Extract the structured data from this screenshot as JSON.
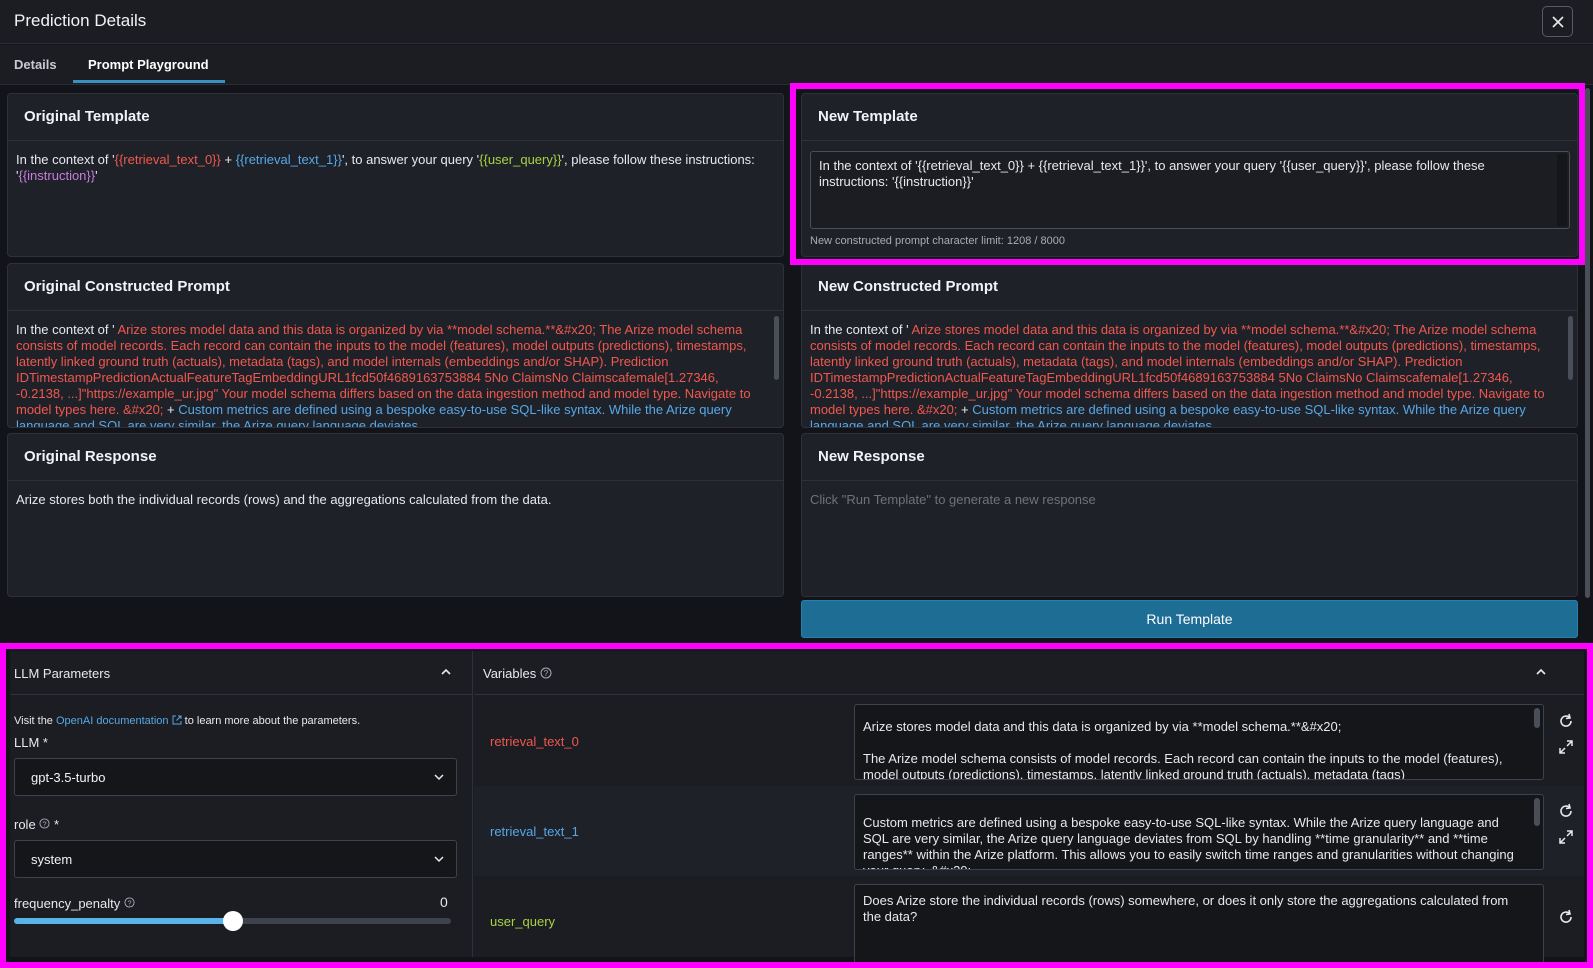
{
  "header": {
    "title": "Prediction Details"
  },
  "tabs": [
    {
      "label": "Details"
    },
    {
      "label": "Prompt Playground"
    }
  ],
  "original_template": {
    "title": "Original Template",
    "parts": [
      "In the context of '",
      "{{retrieval_text_0}}",
      " + ",
      "{{retrieval_text_1}}",
      "', to answer your query '",
      "{{user_query}}",
      "', please follow these instructions: '",
      "{{instruction}}",
      "'"
    ]
  },
  "new_template": {
    "title": "New Template",
    "text": "In the context of '{{retrieval_text_0}} + {{retrieval_text_1}}', to answer your query '{{user_query}}', please follow these instructions: '{{instruction}}'",
    "char_limit": "New constructed prompt character limit: 1208 / 8000"
  },
  "original_constructed": {
    "title": "Original Constructed Prompt",
    "prefix": "In the context of '",
    "red": " Arize stores model data and this data is organized by via **model schema.**&#x20; The Arize model schema consists of model records. Each record can contain the inputs to the model (features), model outputs (predictions), timestamps, latently linked ground truth (actuals), metadata (tags), and model internals (embeddings and/or SHAP). Prediction IDTimestampPredictionActualFeatureTagEmbeddingURL1fcd50f4689163753884 5No ClaimsNo Claimscafemale[1.27346, -0.2138, ...]\"https://example_ur.jpg\" Your model schema differs based on the data ingestion method and model type. Navigate to model types here. &#x20;",
    "plus": " + ",
    "blue": "Custom metrics are defined using a bespoke easy-to-use SQL-like syntax. While the Arize query language and SQL are very similar, the Arize query language deviates"
  },
  "new_constructed": {
    "title": "New Constructed Prompt",
    "prefix": "In the context of '",
    "red": " Arize stores model data and this data is organized by via **model schema.**&#x20; The Arize model schema consists of model records. Each record can contain the inputs to the model (features), model outputs (predictions), timestamps, latently linked ground truth (actuals), metadata (tags), and model internals (embeddings and/or SHAP). Prediction IDTimestampPredictionActualFeatureTagEmbeddingURL1fcd50f4689163753884 5No ClaimsNo Claimscafemale[1.27346, -0.2138, ...]\"https://example_ur.jpg\" Your model schema differs based on the data ingestion method and model type. Navigate to model types here. &#x20;",
    "plus": " + ",
    "blue": "Custom metrics are defined using a bespoke easy-to-use SQL-like syntax. While the Arize query language and SQL are very similar, the Arize query language deviates"
  },
  "original_response": {
    "title": "Original Response",
    "text": "Arize stores both the individual records (rows) and the aggregations calculated from the data."
  },
  "new_response": {
    "title": "New Response",
    "placeholder": "Click \"Run Template\" to generate a new response"
  },
  "run_button": {
    "label": "Run Template"
  },
  "llm_parameters": {
    "title": "LLM Parameters",
    "info_prefix": "Visit the ",
    "info_link": "OpenAI documentation",
    "info_suffix": " to learn more about the parameters.",
    "llm_label": "LLM *",
    "llm_value": "gpt-3.5-turbo",
    "role_label": "role",
    "role_required": "*",
    "role_value": "system",
    "freq_label": "frequency_penalty",
    "freq_value": "0",
    "freq_slider_fraction": 0.5
  },
  "variables": {
    "title": "Variables",
    "rows": [
      {
        "name": "retrieval_text_0",
        "color": "#f0584d",
        "text": "Arize stores model data and this data is organized by via **model schema.**&#x20;\n\nThe Arize model schema consists of model records. Each record can contain the inputs to the model (features), model outputs (predictions), timestamps, latently linked ground truth (actuals), metadata (tags)"
      },
      {
        "name": "retrieval_text_1",
        "color": "#56a8e6",
        "text": "Custom metrics are defined using a bespoke easy-to-use SQL-like syntax. While the Arize query language and SQL are very similar, the Arize query language deviates from SQL by handling **time granularity** and **time ranges** within the Arize platform. This allows you to easily switch time ranges and granularities without changing your query. &#x20;"
      },
      {
        "name": "user_query",
        "color": "#a9d23f",
        "text": "Does Arize store the individual records (rows) somewhere, or does it only store the aggregations calculated from the data?"
      }
    ]
  },
  "colors": {
    "highlight": "#ff00ff",
    "accent": "#1d6d95",
    "tab_underline": "#3a8fc1"
  }
}
